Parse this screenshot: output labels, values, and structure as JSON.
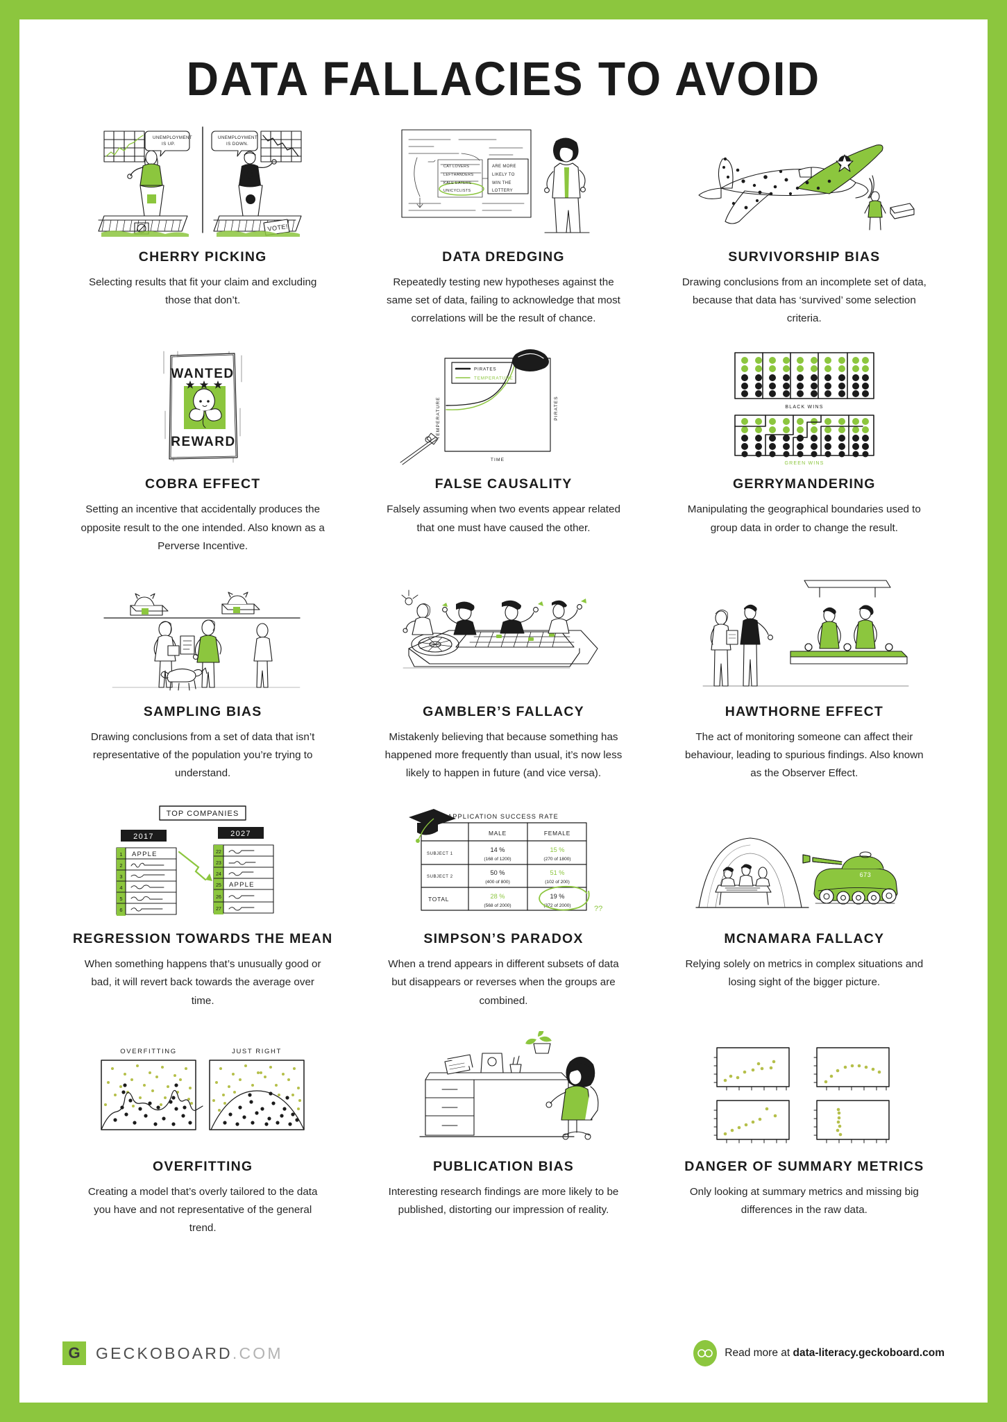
{
  "poster": {
    "title": "DATA FALLACIES TO AVOID",
    "accent_color": "#8CC63E",
    "background_color": "#FFFFFF",
    "border_color": "#8CC63E"
  },
  "cards": [
    {
      "title": "CHERRY PICKING",
      "desc": "Selecting results that fit your claim and excluding those that don’t.",
      "art": "two-politicians-podiums",
      "labels": {
        "bubble_left": "UNEMPLOYMENT IS UP.",
        "bubble_right": "UNEMPLOYMENT IS DOWN.",
        "sign": "VOTE!"
      }
    },
    {
      "title": "DATA DREDGING",
      "desc": "Repeatedly testing new hypotheses against the same set of data, failing to acknowledge that most correlations will be the result of chance.",
      "art": "whiteboard-presenter",
      "labels": {
        "list": [
          "CAT LOVERS",
          "LEFTHANDERS",
          "KALE EATERS",
          "UNICYCLISTS"
        ],
        "highlighted": "UNICYCLISTS",
        "conclusion": "ARE MORE LIKELY TO WIN THE LOTTERY"
      }
    },
    {
      "title": "SURVIVORSHIP BIAS",
      "desc": "Drawing conclusions from an incomplete set of data, because that data has ‘survived’ some selection criteria.",
      "art": "bullet-riddled-plane",
      "labels": {}
    },
    {
      "title": "COBRA EFFECT",
      "desc": "Setting an incentive that accidentally produces the opposite result to the one intended. Also known as a Perverse Incentive.",
      "art": "wanted-poster-cobra",
      "labels": {
        "top": "WANTED",
        "bottom": "REWARD",
        "stars": 3
      }
    },
    {
      "title": "FALSE CAUSALITY",
      "desc": "Falsely assuming when two events appear related that one must have caused the other.",
      "art": "pirates-temperature-chart",
      "labels": {
        "legend": [
          "PIRATES",
          "TEMPERATURE"
        ],
        "y_left": "TEMPERATURE",
        "y_right": "PIRATES",
        "x": "TIME"
      }
    },
    {
      "title": "GERRYMANDERING",
      "desc": "Manipulating the geographical boundaries used to group data in order to change the result.",
      "art": "district-dot-grids",
      "labels": {
        "grid_one": "BLACK WINS",
        "grid_two": "GREEN WINS"
      }
    },
    {
      "title": "SAMPLING BIAS",
      "desc": "Drawing conclusions from a set of data that isn’t representative of the population you’re trying to understand.",
      "art": "dog-owners-surveyed",
      "labels": {}
    },
    {
      "title": "GAMBLER’S FALLACY",
      "desc": "Mistakenly believing that because something has happened more frequently than usual, it’s now less likely to happen in future (and vice versa).",
      "art": "roulette-table-gamblers",
      "labels": {}
    },
    {
      "title": "HAWTHORNE EFFECT",
      "desc": "The act of monitoring someone can affect their behaviour, leading to spurious findings. Also known as the Observer Effect.",
      "art": "factory-line-observers",
      "labels": {}
    },
    {
      "title": "REGRESSION TOWARDS THE MEAN",
      "desc": "When something happens that’s unusually good or bad, it will revert back towards the average over time.",
      "art": "top-companies-ranking",
      "labels": {
        "heading": "TOP COMPANIES",
        "left_year": "2017",
        "right_year": "2027",
        "left_ranks": [
          "1",
          "2",
          "3",
          "4",
          "5",
          "6"
        ],
        "right_ranks": [
          "22",
          "23",
          "24",
          "25",
          "26",
          "27"
        ],
        "left_entry": {
          "rank": "1",
          "name": "APPLE"
        },
        "right_entry": {
          "rank": "25",
          "name": "APPLE"
        }
      }
    },
    {
      "title": "SIMPSON’S PARADOX",
      "desc": "When a trend appears in different subsets of data but disappears or reverses when the groups are combined.",
      "art": "application-success-table",
      "labels": {
        "annotation": "??"
      }
    },
    {
      "title": "MCNAMARA FALLACY",
      "desc": "Relying solely on metrics in complex situations and losing sight of the bigger picture.",
      "art": "tank-and-war-room",
      "labels": {
        "tank_number": "673"
      }
    },
    {
      "title": "OVERFITTING",
      "desc": "Creating a model that’s overly tailored to the data you have and not representative of the general trend.",
      "art": "overfitting-scatter-pair",
      "labels": {
        "left_chart": "OVERFITTING",
        "right_chart": "JUST RIGHT"
      }
    },
    {
      "title": "PUBLICATION BIAS",
      "desc": "Interesting research findings are more likely to be published, distorting our impression of reality.",
      "art": "researcher-at-desk",
      "labels": {}
    },
    {
      "title": "DANGER OF SUMMARY METRICS",
      "desc": "Only looking at summary metrics and missing big differences in the raw data.",
      "art": "anscombe-quartet",
      "labels": {}
    }
  ],
  "chart_data": [
    {
      "id": "false-causality",
      "type": "line",
      "title": "",
      "xlabel": "TIME",
      "ylabel": "TEMPERATURE",
      "y2label": "PIRATES",
      "legend": [
        "PIRATES",
        "TEMPERATURE"
      ],
      "legend_position": "top-left",
      "grid": false,
      "series": [
        {
          "name": "PIRATES",
          "color": "#1b1b1b",
          "values": [
            62,
            62,
            61,
            58,
            52,
            42,
            26,
            5
          ]
        },
        {
          "name": "TEMPERATURE",
          "color": "#8CC63E",
          "values": [
            57,
            57,
            58,
            61,
            66,
            75,
            88,
            100
          ]
        }
      ],
      "x": [
        0,
        1,
        2,
        3,
        4,
        5,
        6,
        7
      ]
    },
    {
      "id": "simpsons-paradox",
      "type": "table",
      "title": "APPLICATION SUCCESS RATE",
      "columns": [
        "",
        "MALE",
        "FEMALE"
      ],
      "rows": [
        [
          "SUBJECT 1",
          "14 %\n(168 of 1200)",
          "15 %\n(270 of 1800)"
        ],
        [
          "SUBJECT 2",
          "50 %\n(400 of 800)",
          "51 %\n(102 of 200)"
        ],
        [
          "TOTAL",
          "28 %\n(568 of 2000)",
          "19 %\n(372 of 2000)"
        ]
      ],
      "highlighted_cells": [
        "FEMALE/SUBJECT 1",
        "FEMALE/SUBJECT 2",
        "MALE/TOTAL"
      ],
      "circled_cell": "FEMALE/TOTAL"
    },
    {
      "id": "gerrymandering",
      "type": "heatmap",
      "grid_cols": 10,
      "grid_rows": 5,
      "green_rows": 2,
      "black_rows": 3,
      "panels": [
        {
          "label": "BLACK WINS",
          "districts": "vertical-stripes",
          "district_count": 5
        },
        {
          "label": "GREEN WINS",
          "districts": "irregular",
          "district_count": 5
        }
      ]
    },
    {
      "id": "overfitting",
      "type": "scatter",
      "panels": [
        {
          "title": "OVERFITTING",
          "boundary": "wiggly"
        },
        {
          "title": "JUST RIGHT",
          "boundary": "smooth-arc"
        }
      ],
      "classes": [
        {
          "name": "upper",
          "color": "#b5bf4a"
        },
        {
          "name": "lower",
          "color": "#1b1b1b"
        }
      ]
    },
    {
      "id": "anscombe-quartet",
      "type": "scatter",
      "panel_count": 4,
      "point_color": "#b5bf4a",
      "panels": [
        {
          "shape": "linear-noisy",
          "x": [
            1,
            2,
            3,
            4,
            5,
            6,
            7,
            8,
            9,
            10
          ],
          "y": [
            2,
            3,
            3.5,
            4.5,
            5,
            6.5,
            6,
            7.5,
            7,
            8
          ]
        },
        {
          "shape": "curved",
          "x": [
            1,
            2,
            3,
            4,
            5,
            6,
            7,
            8,
            9,
            10
          ],
          "y": [
            1.5,
            3,
            4.5,
            5.5,
            6,
            6.2,
            6,
            5.6,
            5,
            4.2
          ]
        },
        {
          "shape": "linear-outlier",
          "x": [
            1,
            2,
            3,
            4,
            5,
            6,
            7,
            8,
            9,
            10
          ],
          "y": [
            2,
            2.6,
            3.2,
            3.8,
            4.4,
            5,
            5.6,
            9.2,
            6.8,
            6.2
          ]
        },
        {
          "shape": "vertical-cluster",
          "x": [
            3,
            3,
            3,
            3,
            3,
            3,
            3,
            3,
            3,
            8
          ],
          "y": [
            2,
            3,
            4,
            5,
            6,
            7,
            8,
            5.5,
            4.5,
            6
          ]
        }
      ]
    },
    {
      "id": "cherry-picking",
      "type": "line",
      "panels": [
        {
          "name": "up-trend",
          "trend": "rising",
          "color": "#b5bf4a"
        },
        {
          "name": "down-trend",
          "trend": "falling",
          "color": "#1b1b1b"
        }
      ]
    },
    {
      "id": "regression-to-mean",
      "type": "table",
      "title": "TOP COMPANIES",
      "columns": [
        "2017",
        "2027"
      ],
      "rows": [
        [
          "1 APPLE",
          "22"
        ],
        [
          "2",
          "23"
        ],
        [
          "3",
          "24"
        ],
        [
          "4",
          "25 APPLE"
        ],
        [
          "5",
          "26"
        ],
        [
          "6",
          "27"
        ]
      ]
    }
  ],
  "footer": {
    "logo_letter": "G",
    "brand_name": "GECKOBOARD",
    "brand_tld": ".COM",
    "readmore_prefix": "Read more at ",
    "readmore_link": "data-literacy.geckoboard.com"
  }
}
